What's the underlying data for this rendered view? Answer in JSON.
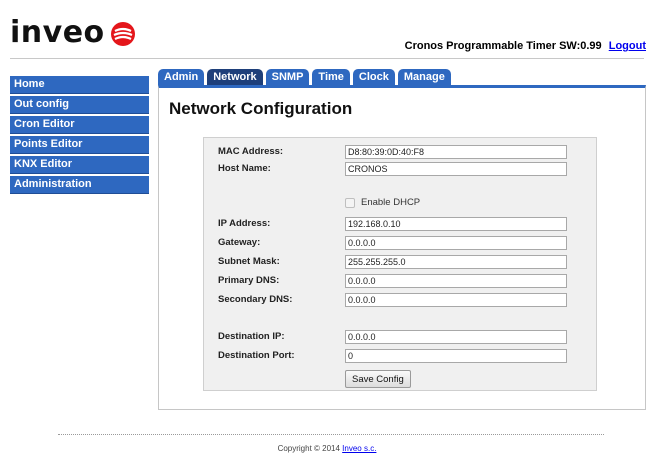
{
  "header": {
    "logo_text": "inveo",
    "product_info": "Cronos Programmable Timer SW:0.99",
    "logout_label": "Logout"
  },
  "sidebar": {
    "items": [
      {
        "label": "Home"
      },
      {
        "label": "Out config"
      },
      {
        "label": "Cron Editor"
      },
      {
        "label": "Points Editor"
      },
      {
        "label": "KNX Editor"
      },
      {
        "label": "Administration"
      }
    ]
  },
  "tabs": [
    {
      "label": "Admin",
      "active": false
    },
    {
      "label": "Network",
      "active": true
    },
    {
      "label": "SNMP",
      "active": false
    },
    {
      "label": "Time",
      "active": false
    },
    {
      "label": "Clock",
      "active": false
    },
    {
      "label": "Manage",
      "active": false
    }
  ],
  "page": {
    "title": "Network Configuration"
  },
  "form": {
    "mac": {
      "label": "MAC Address:",
      "value": "D8:80:39:0D:40:F8"
    },
    "host": {
      "label": "Host Name:",
      "value": "CRONOS"
    },
    "dhcp": {
      "label": "Enable DHCP",
      "checked": false
    },
    "ip": {
      "label": "IP Address:",
      "value": "192.168.0.10"
    },
    "gateway": {
      "label": "Gateway:",
      "value": "0.0.0.0"
    },
    "mask": {
      "label": "Subnet Mask:",
      "value": "255.255.255.0"
    },
    "dns1": {
      "label": "Primary DNS:",
      "value": "0.0.0.0"
    },
    "dns2": {
      "label": "Secondary DNS:",
      "value": "0.0.0.0"
    },
    "dest_ip": {
      "label": "Destination IP:",
      "value": "0.0.0.0"
    },
    "dest_port": {
      "label": "Destination Port:",
      "value": "0"
    },
    "save_label": "Save Config"
  },
  "footer": {
    "copyright": "Copyright © 2014",
    "company_link": "Inveo s.c."
  },
  "colors": {
    "nav_blue": "#2e68c0",
    "active_tab": "#1e3f7a",
    "logo_red": "#e4161b"
  },
  "icons": {
    "logo_mark": "inveo-logo-icon",
    "dhcp_checkbox": "checkbox-unchecked"
  }
}
